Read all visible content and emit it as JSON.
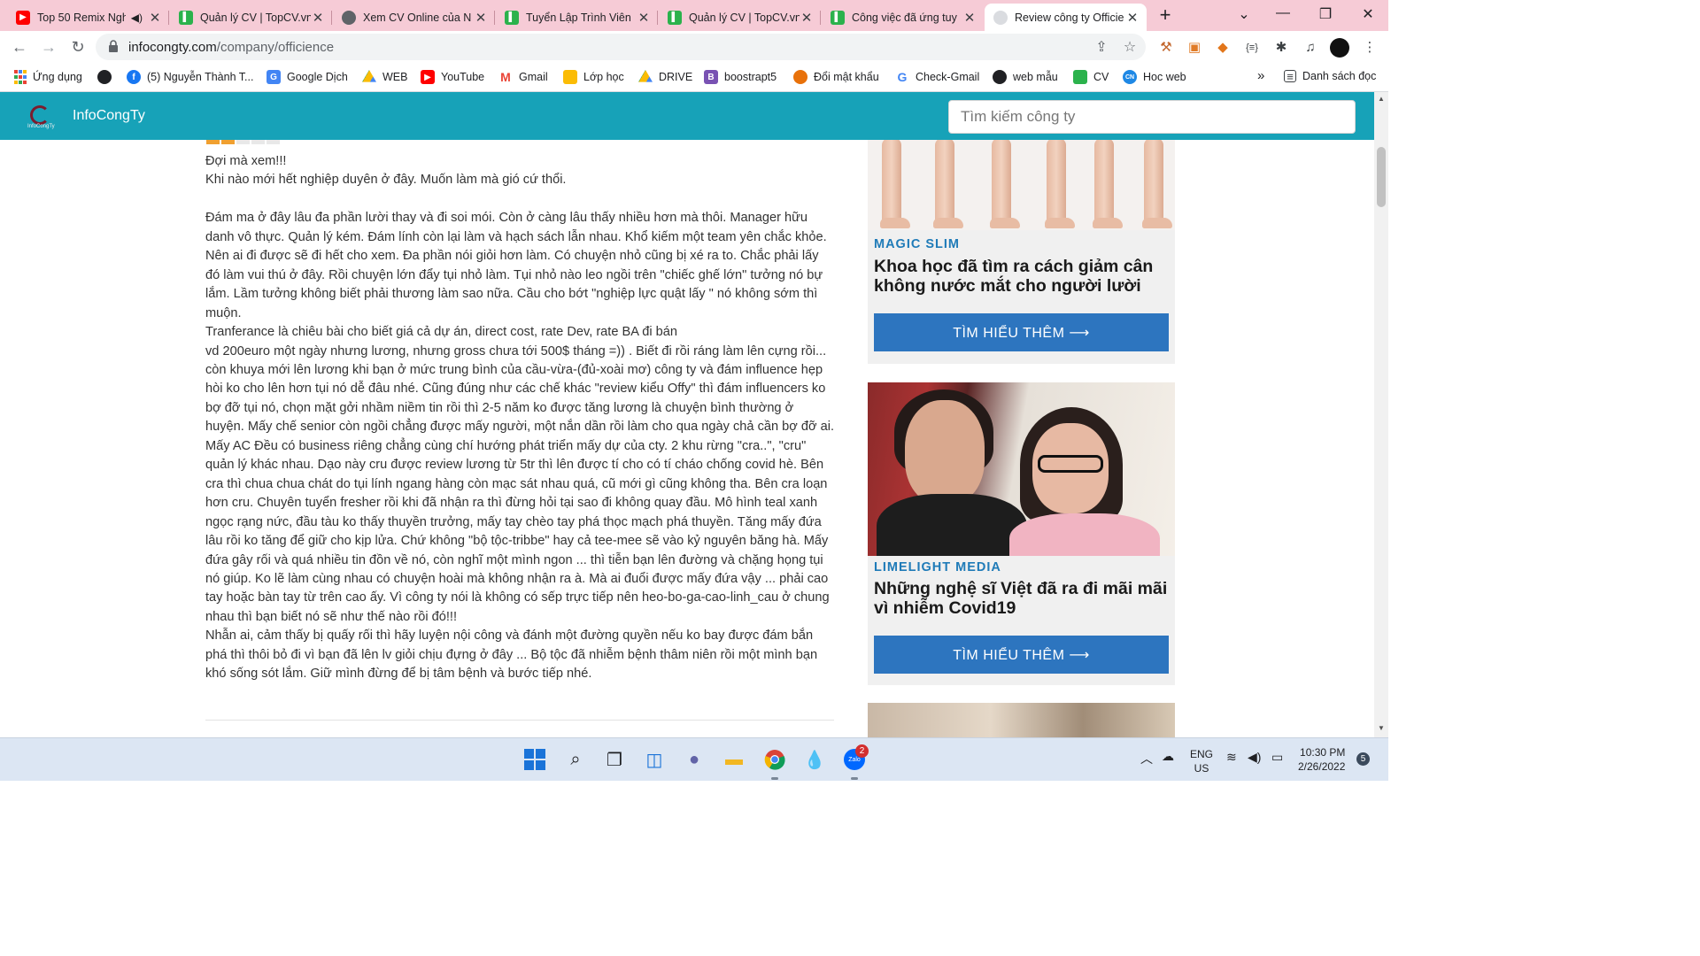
{
  "browser": {
    "tabs": [
      {
        "title": "Top 50 Remix Ngh",
        "icon": "youtube-icon",
        "audio": true
      },
      {
        "title": "Quản lý CV | TopCV.vn",
        "icon": "topcv-icon"
      },
      {
        "title": "Xem CV Online của N",
        "icon": "globe-icon"
      },
      {
        "title": "Tuyển Lập Trình Viên",
        "icon": "topcv-icon"
      },
      {
        "title": "Quản lý CV | TopCV.vn",
        "icon": "topcv-icon"
      },
      {
        "title": "Công việc đã ứng tuy",
        "icon": "topcv-icon"
      },
      {
        "title": "Review công ty Officie",
        "icon": "page-icon",
        "active": true
      }
    ],
    "new_tab": "+",
    "url_domain": "infocongty.com",
    "url_path": "/company/officience",
    "bookmarks": [
      {
        "label": "Ứng dụng",
        "icon": "apps-grid-icon"
      },
      {
        "label": "",
        "icon": "globe-icon"
      },
      {
        "label": "(5) Nguyễn Thành T...",
        "icon": "facebook-icon"
      },
      {
        "label": "Google Dịch",
        "icon": "google-translate-icon"
      },
      {
        "label": "WEB",
        "icon": "google-drive-icon"
      },
      {
        "label": "YouTube",
        "icon": "youtube-icon"
      },
      {
        "label": "Gmail",
        "icon": "gmail-icon"
      },
      {
        "label": "Lớp học",
        "icon": "classroom-icon"
      },
      {
        "label": "DRIVE",
        "icon": "google-drive-icon"
      },
      {
        "label": "boostrapt5",
        "icon": "bootstrap-icon"
      },
      {
        "label": "Đổi mật khẩu",
        "icon": "pumpkin-icon"
      },
      {
        "label": "Check-Gmail",
        "icon": "google-icon"
      },
      {
        "label": "web mẫu",
        "icon": "globe-icon"
      },
      {
        "label": "CV",
        "icon": "topcv-icon"
      },
      {
        "label": "Hoc web",
        "icon": "cn-icon"
      }
    ],
    "bookmarks_overflow": "»",
    "reading_list": "Danh sách đọc"
  },
  "site": {
    "brand": "InfoCongTy",
    "logo_caption": "InfoCongTy",
    "search_placeholder": "Tìm kiếm công ty"
  },
  "review": {
    "rating": 2,
    "rating_max": 5,
    "paragraphs": [
      "Đợi mà xem!!!",
      "Khi nào mới hết nghiệp duyên ở đây. Muốn làm mà gió cứ thổi.",
      "",
      "Đám ma ở đây lâu đa phần lười thay và đi soi mói. Còn ở càng lâu thấy nhiều hơn mà thôi. Manager hữu danh vô thực. Quản lý kém. Đám lính còn lại làm và hạch sách lẫn nhau. Khổ kiếm một team yên chắc khỏe. Nên ai đi được sẽ đi hết cho xem. Đa phần nói giỏi hơn làm. Có chuyện nhỏ cũng bị xé ra to. Chắc phải lấy đó làm vui thú ở đây. Rồi chuyện lớn đẩy tụi nhỏ làm. Tụi nhỏ nào leo ngồi trên \"chiếc ghế lớn\" tưởng nó bự lắm. Lầm tưởng không biết phải thương làm sao nữa. Cầu cho bớt \"nghiệp lực quật lấy \" nó không sớm thì muộn.",
      "Tranferance là chiêu bài cho biết giá cả dự án, direct cost, rate Dev, rate BA đi bán",
      "vd 200euro một ngày nhưng lương, nhưng gross chưa tới 500$ tháng =)) . Biết đi rồi ráng làm lên cựng rồi... còn khuya mới lên lương khi bạn ở mức trung bình của cầu-vừa-(đủ-xoài mơ) công ty và đám influence hẹp hòi ko cho lên hơn tụi nó dễ đâu nhé. Cũng đúng như các chế khác \"review kiểu Offy\" thì đám influencers ko bợ đỡ tụi nó, chọn mặt gởi nhầm niềm tin rồi thì 2-5 năm ko được tăng lương là chuyện bình thường ở huyện. Mấy chế senior còn ngồi chẳng được mấy người, một nắn dần rồi làm cho qua ngày chả cần bợ đỡ ai. Mấy AC Đều có business riêng chẳng cùng chí hướng phát triển mấy dự của cty. 2 khu rừng \"cra..\", \"cru\" quản lý khác nhau. Dạo này cru được review lương từ 5tr thì lên được tí cho có tí cháo chống covid hè. Bên cra thì chua chua chát do tụi lính ngang hàng còn mạc sát nhau quá, cũ mới gì cũng không tha. Bên cra loạn hơn cru. Chuyên tuyển fresher rồi khi đã nhận ra thì đừng hỏi tại sao đi không quay đầu. Mô hình teal xanh ngọc rạng nức, đầu tàu ko thấy thuyền trưởng, mấy tay chèo tay phá thọc mạch phá thuyền. Tăng mấy đứa lâu rồi ko tăng để giữ cho kịp lửa. Chứ không \"bộ tộc-tribbe\" hay cả tee-mee sẽ vào kỷ nguyên băng hà. Mấy đứa gây rối và quá nhiều tin đồn về nó, còn nghĩ một mình ngon ... thì tiễn bạn lên đường và chặng họng tụi nó giúp. Ko lẽ làm cùng nhau có chuyện hoài mà không nhận ra à. Mà ai đuổi được mấy đứa vậy ... phải cao tay hoặc bàn tay từ trên cao ấy. Vì công ty nói là không có sếp trực tiếp nên heo-bo-ga-cao-linh_cau ở chung nhau thì bạn biết nó sẽ như thế nào rồi đó!!!",
      "Nhẫn ai, cảm thấy bị quấy rối thì hãy luyện nội công và đánh một đường quyền nếu ko bay được đám bắn phá thì thôi bỏ đi vì bạn đã lên lv giỏi chịu đựng ở đây ... Bộ tộc đã nhiễm bệnh thâm niên rồi một mình bạn khó sống sót lắm. Giữ mình đừng để bị tâm bệnh và bước tiếp nhé."
    ]
  },
  "ads": [
    {
      "sponsor": "MAGIC SLIM",
      "title": "Khoa học đã tìm ra cách giảm cân không nước mắt cho người lười",
      "button": "TÌM HIỂU THÊM ⟶"
    },
    {
      "sponsor": "LIMELIGHT MEDIA",
      "title": "Những nghệ sĩ Việt đã ra đi mãi mãi vì nhiễm Covid19",
      "button": "TÌM HIỂU THÊM ⟶"
    }
  ],
  "taskbar": {
    "zalo_badge": "2",
    "language_top": "ENG",
    "language_bottom": "US",
    "time": "10:30 PM",
    "date": "2/26/2022",
    "notifications": "5"
  },
  "colors": {
    "tabstrip": "#f6cbd6",
    "site_header": "#17a2b8",
    "ad_button": "#2d75bf",
    "sponsor": "#1f7bb8",
    "taskbar": "#dce6f3"
  }
}
